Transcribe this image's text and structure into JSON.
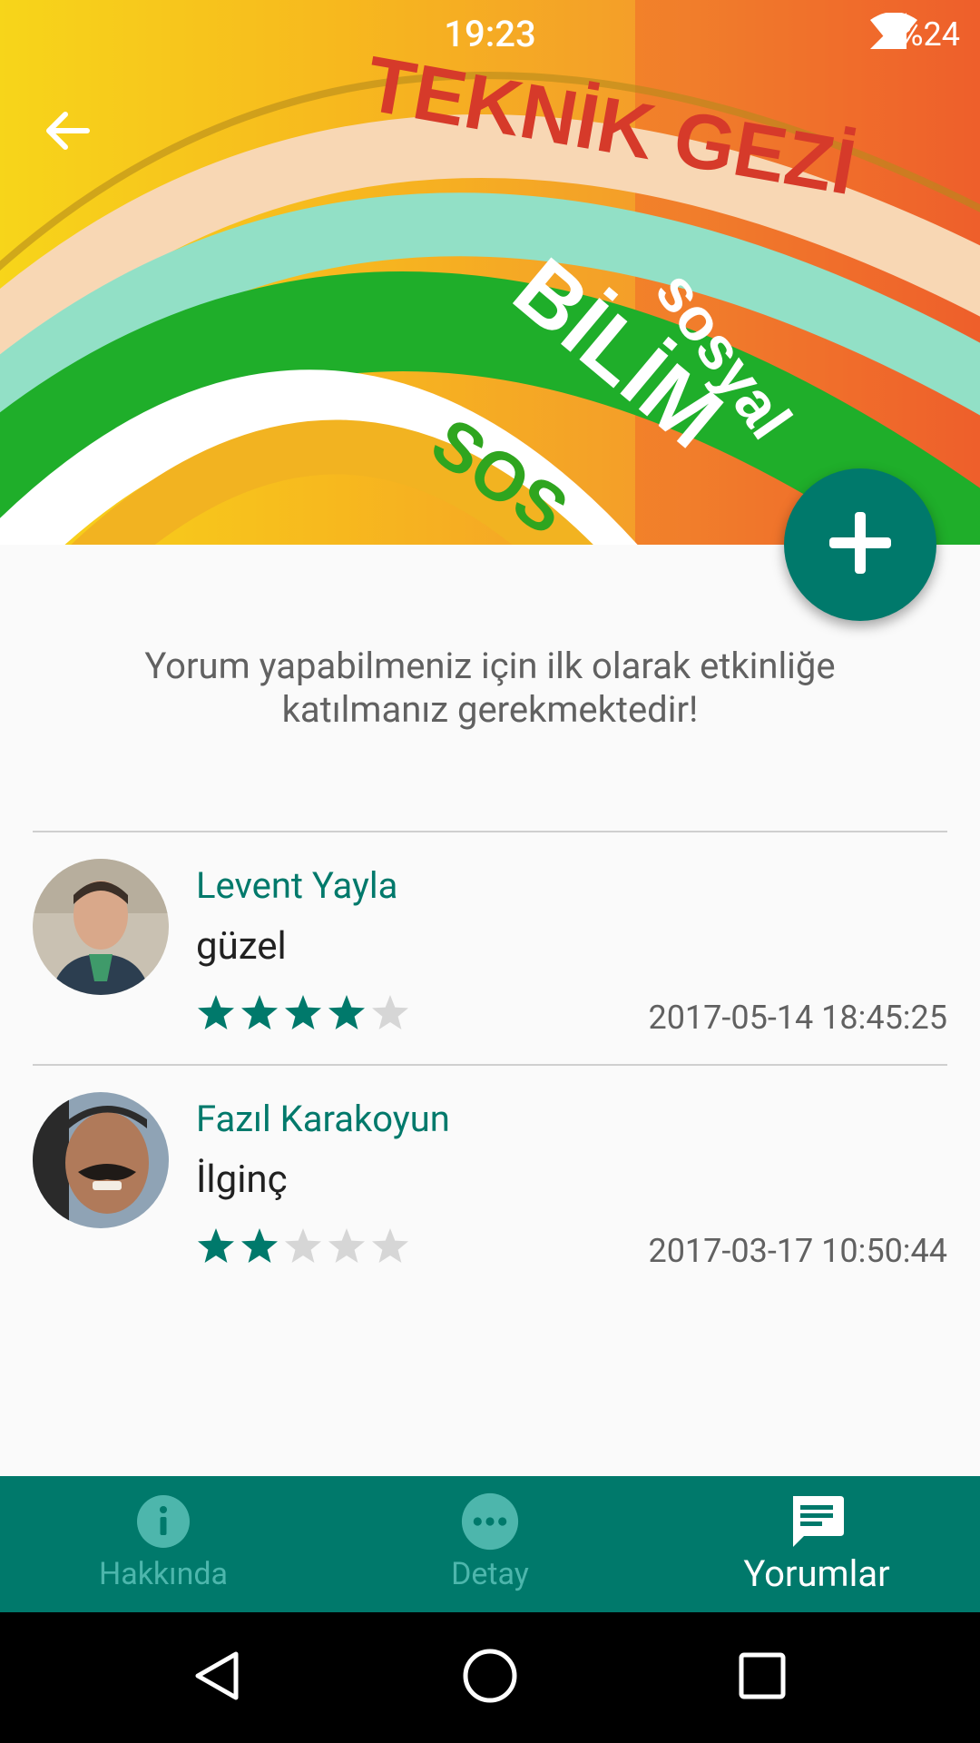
{
  "status_bar": {
    "time": "19:23",
    "battery": "%24"
  },
  "header": {
    "banner_texts": {
      "line1": "TEKNİK GEZİ",
      "line2": "sosyal",
      "line3": "BİLİM",
      "line4": "SOS"
    }
  },
  "notice": {
    "text": "Yorum yapabilmeniz için ilk olarak etkinliğe katılmanız gerekmektedir!"
  },
  "comments": [
    {
      "name": "Levent Yayla",
      "text": "güzel",
      "rating": 4,
      "max_rating": 5,
      "date": "2017-05-14 18:45:25"
    },
    {
      "name": "Fazıl Karakoyun",
      "text": "İlginç",
      "rating": 2,
      "max_rating": 5,
      "date": "2017-03-17 10:50:44"
    }
  ],
  "bottom_nav": {
    "items": [
      {
        "label": "Hakkında",
        "icon": "info-icon",
        "active": false
      },
      {
        "label": "Detay",
        "icon": "more-horizontal-icon",
        "active": false
      },
      {
        "label": "Yorumlar",
        "icon": "comment-icon",
        "active": true
      }
    ]
  },
  "colors": {
    "primary": "#00796b",
    "star_filled": "#00796b",
    "star_empty": "#d6d6d6",
    "inactive_nav": "#4db6ac"
  }
}
